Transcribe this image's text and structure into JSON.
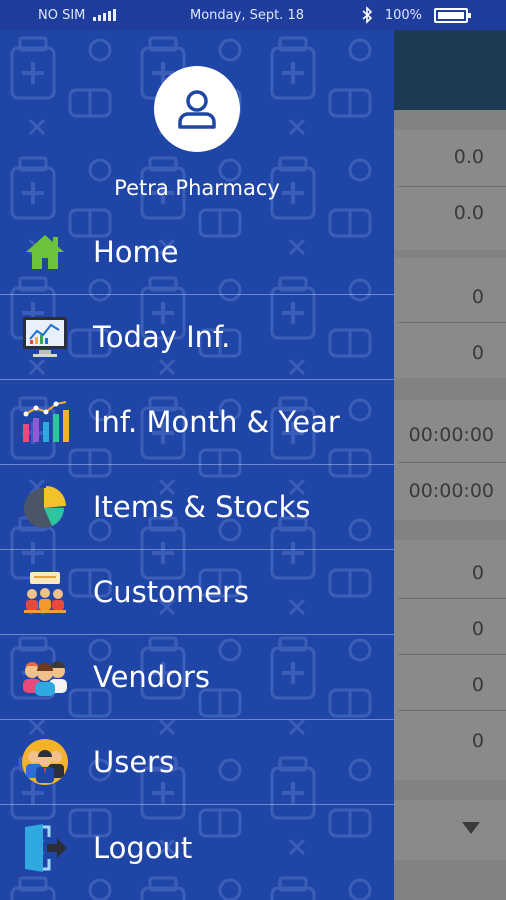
{
  "status_bar": {
    "carrier": "NO SIM",
    "date": "Monday, Sept. 18",
    "battery": "100%",
    "icons": [
      "signal-icon",
      "bluetooth-icon",
      "battery-icon"
    ]
  },
  "drawer": {
    "pharmacy_name": "Petra Pharmacy",
    "menu": [
      {
        "label": "Home",
        "icon": "home-icon"
      },
      {
        "label": "Today Inf.",
        "icon": "monitor-chart-icon"
      },
      {
        "label": "Inf. Month & Year",
        "icon": "bar-chart-icon"
      },
      {
        "label": "Items & Stocks",
        "icon": "pie-chart-icon"
      },
      {
        "label": "Customers",
        "icon": "customers-icon"
      },
      {
        "label": "Vendors",
        "icon": "vendors-icon"
      },
      {
        "label": "Users",
        "icon": "users-icon"
      },
      {
        "label": "Logout",
        "icon": "logout-icon"
      }
    ]
  },
  "background": {
    "values": [
      "0.0",
      "0.0",
      "0",
      "0",
      "00:00:00",
      "00:00:00",
      "0",
      "0",
      "0",
      "0"
    ]
  },
  "colors": {
    "drawer": "#1f45a6",
    "status_bar": "#1f3d9c",
    "overlay": "#828282"
  }
}
